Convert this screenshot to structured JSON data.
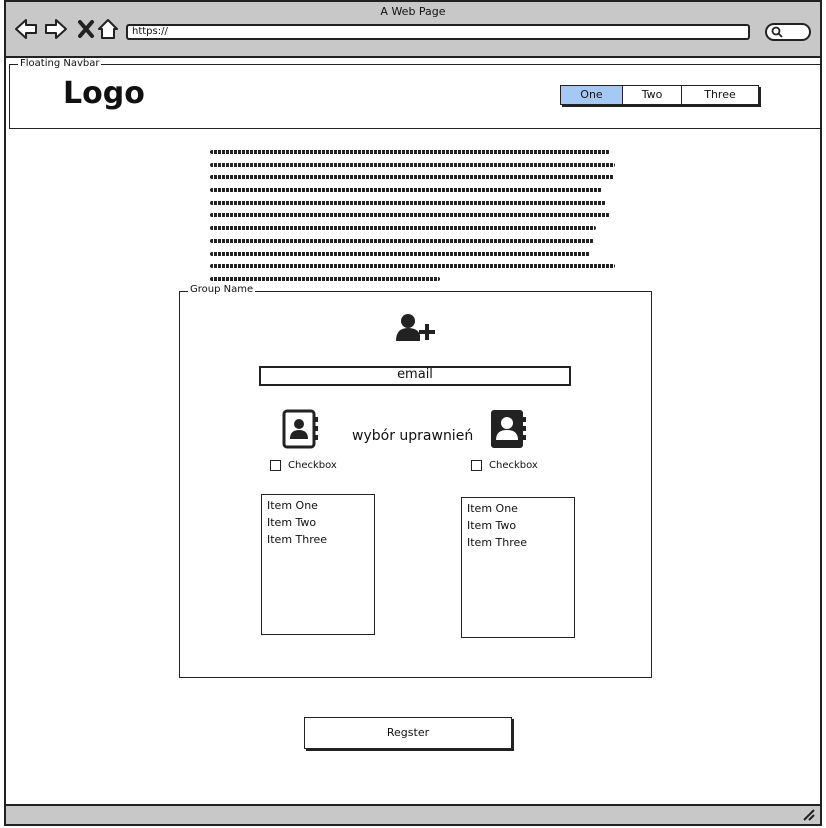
{
  "window": {
    "title": "A Web Page"
  },
  "browser": {
    "url": "https://",
    "icons": [
      "back-arrow-icon",
      "forward-arrow-icon",
      "close-x-icon",
      "home-icon",
      "search-icon"
    ]
  },
  "navbar": {
    "group_label": "Floating Navbar",
    "logo": "Logo",
    "tabs": [
      {
        "label": "One",
        "active": true
      },
      {
        "label": "Two",
        "active": false
      },
      {
        "label": "Three",
        "active": false
      }
    ]
  },
  "colors": {
    "active_tab": "#a6c8f5",
    "chrome": "#c8c8c8"
  },
  "group": {
    "label": "Group Name",
    "icon": "add-user-icon",
    "email_label": "email",
    "permissions_label": "wybór uprawnień",
    "left_contact_icon": "contact-book-outline-icon",
    "right_contact_icon": "contact-book-filled-icon",
    "left_checkbox": "Checkbox",
    "right_checkbox": "Checkbox",
    "left_list": [
      "Item One",
      "Item Two",
      "Item Three"
    ],
    "right_list": [
      "Item One",
      "Item Two",
      "Item Three"
    ]
  },
  "register_label": "Regster"
}
